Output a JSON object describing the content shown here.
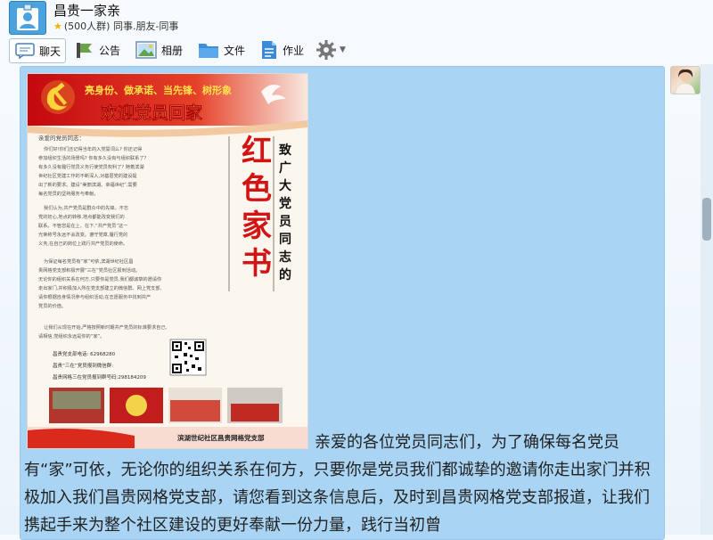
{
  "window": {
    "title": "昌贵一家亲",
    "subtitle": "(500人群) 同事.朋友-同事"
  },
  "toolbar": {
    "items": [
      {
        "label": "聊天",
        "icon": "chat-icon"
      },
      {
        "label": "公告",
        "icon": "announcement-icon"
      },
      {
        "label": "相册",
        "icon": "photo-album-icon"
      },
      {
        "label": "文件",
        "icon": "folder-icon"
      },
      {
        "label": "作业",
        "icon": "homework-icon"
      }
    ],
    "settings_icon": "gear-icon"
  },
  "message": {
    "poster": {
      "banner_slogan": "亮身份、做承诺、当先锋、树形象",
      "banner_title": "欢迎党员回家",
      "salutation": "亲爱的党员同志：",
      "vertical_title": "红色家书",
      "vertical_subtitle": "致广大党员同志的",
      "paragraphs": [
        "你们好!你们还记得当年的入党誓词么? 你还记得参加组织生活的场景吗? 你有多久没有与组织联系了? 有多久没有履行党员义务行使党员权利了? 随着滨湖世纪社区党建工作的不断深入,对基层党的建设提出了新的要求。建设“美丽滨湖、幸福世纪”,需要每名党员的坚持服务与奉献。",
        "我们认为,共产党员是群众中的先锋。不忘党的初心,地点的转移,地点都能改变我们的联系。不管您是在上、在下,“共产党员”这一光荣称号永远不会改变。遵守党章,履行党的义务,在自己的岗位上践行共产党员的使命。",
        "为保证每名党员有“家”可依,滨湖世纪社区昌贵网格党支部积极开展“三在”党员社区报到活动。无论你的组织关系在何方,只要你是党员,我们都诚挚的邀请你走出家门,并积极加入所在党支部建立的微信群、网上党支部,请你根据自身情况参与组织活动,在志愿服务中找到共产党员的价值。",
        "让我们从现在开始,严格按照新时期共产党员的标准要求自己,请相信,党组织永远是你的“家”。"
      ],
      "contact_phone_label": "昌贵党支部电话:",
      "contact_phone": "62968280",
      "wechat_label": "昌贵“三在”党员报到微信群:",
      "wechat_id": "昌贵网格三在党员报到群号码:298184209",
      "footer": "滨湖世纪社区昌贵网格党支部",
      "colors": {
        "red": "#cf1a1a",
        "gold": "#f3d34a"
      }
    },
    "text": "亲爱的各位党员同志们，为了确保每名党员有“家”可依，无论你的组织关系在何方，只要你是党员我们都诚挚的邀请你走出家门并积极加入我们昌贵网格党支部，请您看到这条信息后，及时到昌贵网格党支部报道，让我们携起手来为整个社区建设的更好奉献一份力量，践行当初曾"
  },
  "colors": {
    "chat_bubble_bg": "#a9d4f3",
    "accent": "#3a8ad6"
  }
}
